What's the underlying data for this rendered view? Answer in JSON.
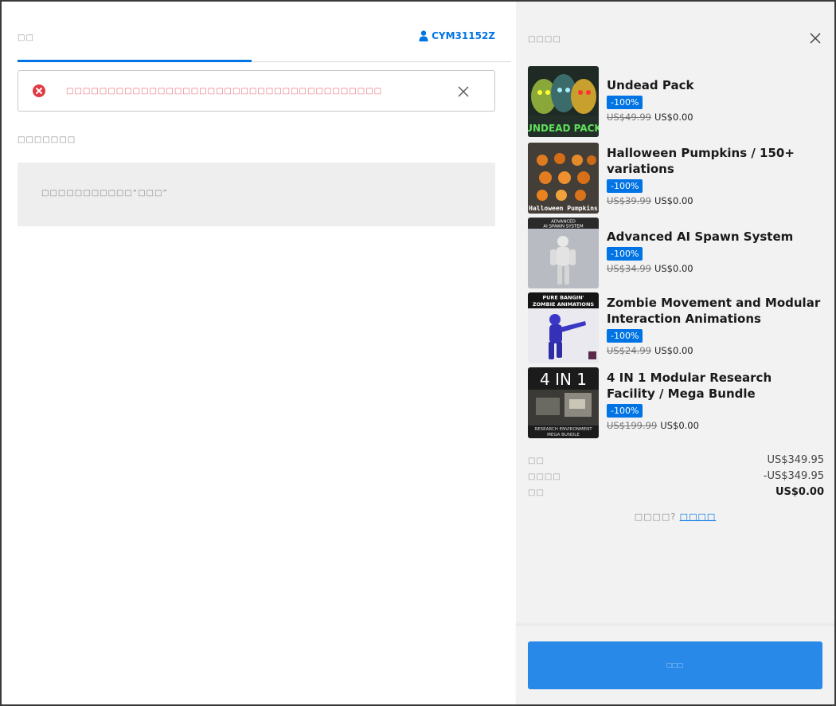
{
  "checkout": {
    "tab_label": "□□",
    "account_name": "CYM31152Z",
    "alert": {
      "message": "□□□□□□□□□□□□□□□□□□□□□□□□□□□□□□□□□□□□□□"
    },
    "payment_section_title": "□□□□□□□",
    "payment_methods_text": "□□□□□□□□□□□“□□□”"
  },
  "summary": {
    "title": "□□□□",
    "items": [
      {
        "name": "Undead Pack",
        "discount": "-100%",
        "old_price": "US$49.99",
        "price": "US$0.00",
        "thumb": "undead-pack-thumbnail"
      },
      {
        "name": "Halloween Pumpkins / 150+ variations",
        "discount": "-100%",
        "old_price": "US$39.99",
        "price": "US$0.00",
        "thumb": "halloween-pumpkins-thumbnail"
      },
      {
        "name": "Advanced AI Spawn System",
        "discount": "-100%",
        "old_price": "US$34.99",
        "price": "US$0.00",
        "thumb": "ai-spawn-thumbnail"
      },
      {
        "name": "Zombie Movement and Modular Interaction Animations",
        "discount": "-100%",
        "old_price": "US$24.99",
        "price": "US$0.00",
        "thumb": "zombie-animations-thumbnail"
      },
      {
        "name": "4 IN 1 Modular Research Facility / Mega Bundle",
        "discount": "-100%",
        "old_price": "US$199.99",
        "price": "US$0.00",
        "thumb": "research-facility-thumbnail"
      }
    ],
    "thumb_text": {
      "undead": "UNDEAD PACK",
      "pumpkins": "Halloween Pumpkins",
      "spawn_line1": "ADVANCED",
      "spawn_line2": "AI SPAWN SYSTEM",
      "zombie_line1": "PURE BANGIN'",
      "zombie_line2": "ZOMBIE ANIMATIONS",
      "facility_big": "4 IN 1",
      "facility_line1": "RESEARCH ENVIRONMENT",
      "facility_line2": "MEGA BUNDLE"
    },
    "totals": {
      "price_label": "□□",
      "price_value": "US$349.95",
      "discount_label": "□□□□",
      "discount_value": "-US$349.95",
      "total_label": "□□",
      "total_value": "US$0.00"
    },
    "help_text": "□□□□?",
    "help_link": "□□□□",
    "order_button": "□□□"
  },
  "colors": {
    "accent": "#0074e4",
    "badge": "#0074e4",
    "button": "#2989e8",
    "error": "#e03a45",
    "panel_bg": "#f2f2f2"
  }
}
